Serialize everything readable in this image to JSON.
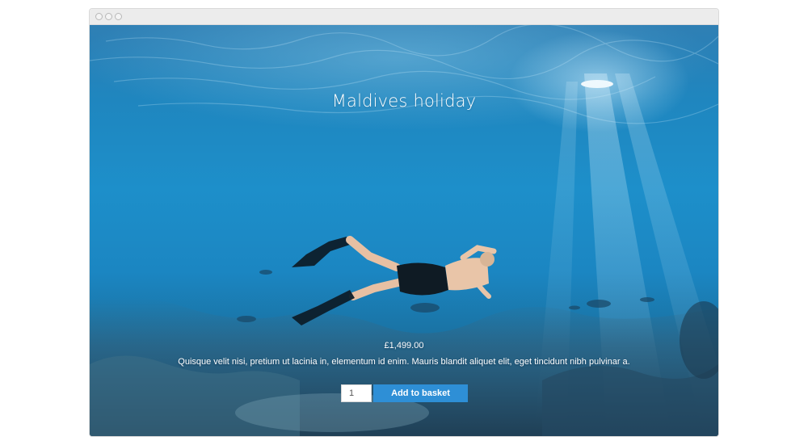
{
  "window": {
    "controls": [
      "close-dot",
      "minimize-dot",
      "zoom-dot"
    ]
  },
  "hero": {
    "title": "Maldives holiday",
    "price": "£1,499.00",
    "description": "Quisque velit nisi, pretium ut lacinia in, elementum id enim. Mauris blandit aliquet elit, eget tincidunt nibh pulvinar a."
  },
  "cart": {
    "quantity": "1",
    "add_label": "Add to basket"
  },
  "colors": {
    "button": "#2e8fd6",
    "water_top": "#2f7fb4",
    "water_bottom": "#1a5577"
  }
}
